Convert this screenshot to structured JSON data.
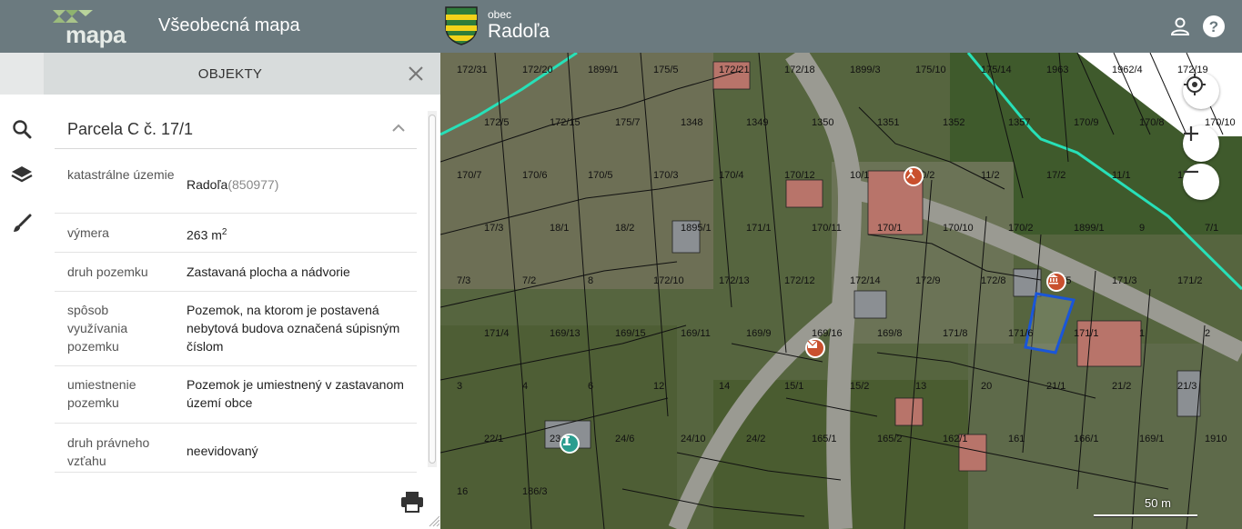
{
  "header": {
    "logo_text": "mapa",
    "app_title": "Všeobecná mapa",
    "municipality_prefix": "obec",
    "municipality_name": "Radoľa"
  },
  "panel": {
    "title": "OBJEKTY",
    "parcel_title": "Parcela C č. 17/1",
    "rows": [
      {
        "label": "katastrálne územie",
        "value": "Radoľa",
        "value_extra": "(850977)"
      },
      {
        "label": "výmera",
        "value": "263 m",
        "value_sup": "2"
      },
      {
        "label": "druh pozemku",
        "value": "Zastavaná plocha a nádvorie"
      },
      {
        "label": "spôsob využívania pozemku",
        "value": "Pozemok, na ktorom je postavená nebytová budova označená súpisným číslom"
      },
      {
        "label": "umiestnenie pozemku",
        "value": "Pozemok je umiestnený v zastavanom území obce"
      },
      {
        "label": "druh právneho vzťahu",
        "value": "neevidovaný"
      }
    ]
  },
  "map": {
    "scale_label": "50 m",
    "parcel_labels": [
      "172/31",
      "172/20",
      "1899/1",
      "175/5",
      "172/21",
      "172/18",
      "1899/3",
      "175/10",
      "175/14",
      "1963",
      "1962/4",
      "172/19",
      "172/5",
      "172/15",
      "175/7",
      "1348",
      "1349",
      "1350",
      "1351",
      "1352",
      "1357",
      "170/9",
      "170/8",
      "170/10",
      "170/7",
      "170/6",
      "170/5",
      "170/3",
      "170/4",
      "170/12",
      "10/1",
      "10/2",
      "11/2",
      "17/2",
      "11/1",
      "17/1",
      "17/3",
      "18/1",
      "18/2",
      "1895/1",
      "171/1",
      "170/11",
      "170/1",
      "170/10",
      "170/2",
      "1899/1",
      "9",
      "7/1",
      "7/3",
      "7/2",
      "8",
      "172/10",
      "172/13",
      "172/12",
      "172/14",
      "172/9",
      "172/8",
      "171/5",
      "171/3",
      "171/2",
      "171/4",
      "169/13",
      "169/15",
      "169/11",
      "169/9",
      "169/16",
      "169/8",
      "171/8",
      "171/6",
      "171/1",
      "1",
      "2",
      "3",
      "4",
      "6",
      "12",
      "14",
      "15/1",
      "15/2",
      "13",
      "20",
      "21/1",
      "21/2",
      "21/3",
      "22/1",
      "23",
      "24/6",
      "24/10",
      "24/2",
      "165/1",
      "165/2",
      "162/1",
      "161",
      "166/1",
      "169/1",
      "1910",
      "16",
      "186/3"
    ],
    "poi_colors": {
      "red": "#c9502e",
      "teal": "#2a9d8f",
      "parcel_highlight": "#1a56d8",
      "boundary": "#27e0b8"
    }
  },
  "icons": {
    "search": "search-icon",
    "layers": "layers-icon",
    "draw": "brush-icon",
    "user": "user-icon",
    "help": "help-icon",
    "close": "close-icon",
    "collapse": "chevron-up-icon",
    "print": "print-icon",
    "locate": "crosshair-icon",
    "zoom_in": "plus-icon",
    "zoom_out": "minus-icon"
  }
}
